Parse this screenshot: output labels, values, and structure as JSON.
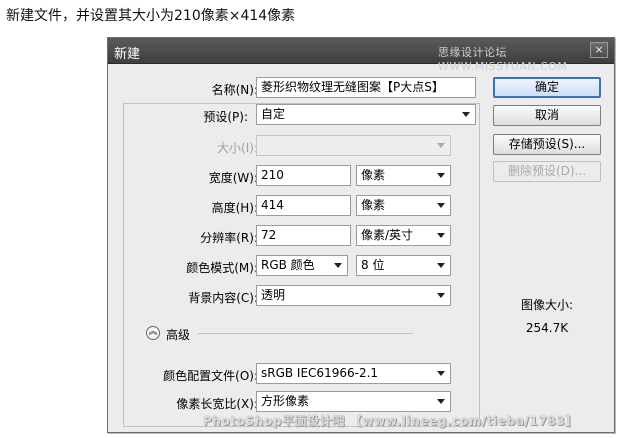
{
  "caption": "新建文件，并设置其大小为210像素×414像素",
  "dialog": {
    "title": "新建",
    "brand_watermark": "思缘设计论坛 WWW.MISSYUAN.COM",
    "close_label": "×"
  },
  "form": {
    "name_label": "名称(N):",
    "name_value": "菱形织物纹理无缝图案【P大点S】",
    "preset_label": "预设(P):",
    "preset_value": "自定",
    "size_label": "大小(I):",
    "size_value": "",
    "width_label": "宽度(W):",
    "width_value": "210",
    "width_unit": "像素",
    "height_label": "高度(H):",
    "height_value": "414",
    "height_unit": "像素",
    "resolution_label": "分辨率(R):",
    "resolution_value": "72",
    "resolution_unit": "像素/英寸",
    "color_mode_label": "颜色模式(M):",
    "color_mode_value": "RGB 颜色",
    "bit_depth_value": "8 位",
    "background_label": "背景内容(C):",
    "background_value": "透明",
    "advanced_label": "高级",
    "color_profile_label": "颜色配置文件(O):",
    "color_profile_value": "sRGB IEC61966-2.1",
    "pixel_aspect_label": "像素长宽比(X):",
    "pixel_aspect_value": "方形像素"
  },
  "buttons": {
    "ok": "确定",
    "cancel": "取消",
    "save_preset": "存储预设(S)...",
    "delete_preset": "删除预设(D)..."
  },
  "image_size": {
    "label": "图像大小:",
    "value": "254.7K"
  },
  "footer_watermark": "PhotoShop平面设计吧 【www.lineeg.com/tieba/1783】"
}
